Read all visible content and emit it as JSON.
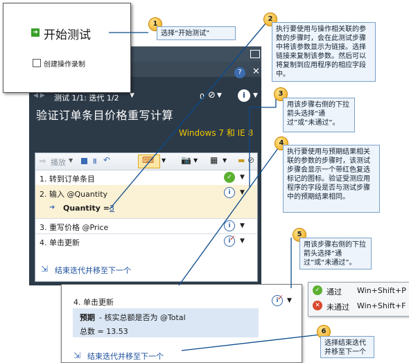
{
  "popup": {
    "start_test_label": "开始测试",
    "create_recording_label": "创建操作录制"
  },
  "runner": {
    "iteration_text": "测试 1/1: 迭代 1/2",
    "attachment_count": "0",
    "title": "验证订单条目价格重写计算",
    "subtitle": "Windows 7 和 IE 8",
    "toolbar": {
      "play_label": "播放"
    },
    "steps": [
      {
        "text": "1. 转到订单条目",
        "status": "passed"
      },
      {
        "text": "2. 输入 @Quantity",
        "status": "info"
      },
      {
        "param_label": "Quantity =",
        "param_value": "3"
      },
      {
        "text": "3. 重写价格 @Price",
        "status": "info"
      },
      {
        "text": "4. 单击更新",
        "status": "info-checkmark"
      }
    ],
    "end_iteration_link": "结束迭代并移至下一个"
  },
  "zoom": {
    "step_text": "4. 单击更新",
    "expected_label": "预期",
    "expected_text": " - 核实总额是否为 @Total",
    "total_text": "总数 = 13.53",
    "end_iteration_link": "结束迭代并移至下一个"
  },
  "status_menu": {
    "items": [
      {
        "label": "通过",
        "shortcut": "Win+Shift+P",
        "icon": "pass-icon",
        "color": "#5cb031"
      },
      {
        "label": "未通过",
        "shortcut": "Win+Shift+F",
        "icon": "fail-icon",
        "color": "#d9482c"
      }
    ]
  },
  "callouts": {
    "c1": {
      "num": "1",
      "text": "选择“开始测试”"
    },
    "c2": {
      "num": "2",
      "text": "执行要使用与操作相关联的参数的步骤时，会在此测试步骤中将该参数显示为链接。选择链接来复制该参数。然后可以将复制到应用程序的相应字段中。"
    },
    "c3": {
      "num": "3",
      "text": "用该步骤右侧的下拉箭头选择“通过”或“未通过”。"
    },
    "c4": {
      "num": "4",
      "text": "执行要使用与预期结果相关联的参数的步骤时，该测试步骤会显示一个带红色复选标记的图标。验证受测应用程序的字段是否与测试步骤中的预期结果相同。"
    },
    "c5": {
      "num": "5",
      "text": "用该步骤右侧的下拉箭头选择“通过”或“未通过”。"
    },
    "c6": {
      "num": "6",
      "text": "选择结束迭代并移至下一个"
    }
  },
  "colors": {
    "runner_bg": "#2c3a48",
    "subtitle": "#f2c700",
    "callout_line": "#0a4a8c",
    "selected_row": "#fbf1d4"
  }
}
